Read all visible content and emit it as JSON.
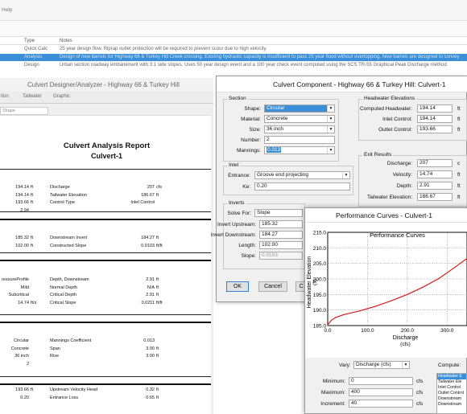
{
  "app": {
    "menu_text": "Help",
    "scenario_table": {
      "headers": [
        "Type",
        "Notes"
      ],
      "rows": [
        {
          "type": "Quick Calc",
          "notes": "25 year design flow.  Riprap outlet protection will be required to prevent scour due to high velocity."
        },
        {
          "type": "Analysis",
          "notes": "Design of new barrels for Highway 66 & Turkey Hill Creek crossing.  Existing hydraulic capacity is insufficient to pass 25 year flood without overtopping.  New barrels are designed to convey",
          "selected": true
        },
        {
          "type": "Design",
          "notes": "Urban section roadway embankment with 3:1 side slopes.  Uses 50 year design event and a 100 year check event computed using the SCS TR-55 Graphical Peak Discharge method"
        }
      ]
    }
  },
  "designer": {
    "title": "Culvert Designer/Analyzer - Highway 66 & Turkey Hill",
    "tabs": [
      "tion",
      "Tailwater",
      "Graphic"
    ],
    "combo_value": "Shape",
    "report": {
      "title": "Culvert Analysis Report",
      "subtitle": "Culvert-1",
      "rows1": [
        {
          "lv": "194.14",
          "lu": "ft",
          "rl": "Discharge",
          "rv": "207",
          "ru": "cfs"
        },
        {
          "lv": "194.14",
          "lu": "ft",
          "rl": "Tailwater Elevation",
          "rv": "186.67",
          "ru": "ft"
        },
        {
          "lv": "193.66",
          "lu": "ft",
          "rl": "Control Type",
          "rv": "Inlet Control",
          "ru": ""
        },
        {
          "lv": "2.94",
          "lu": "",
          "rl": "",
          "rv": "",
          "ru": ""
        }
      ],
      "rows2": [
        {
          "lv": "185.32",
          "lu": "ft",
          "rl": "Downstream Invert",
          "rv": "184.27",
          "ru": "ft"
        },
        {
          "lv": "102.00",
          "lu": "ft",
          "rl": "Constructed Slope",
          "rv": "0.0103",
          "ru": "ft/ft"
        }
      ],
      "rows3": [
        {
          "lv": "ressureProfile",
          "lu": "",
          "rl": "Depth, Downstream",
          "rv": "2.91",
          "ru": "ft"
        },
        {
          "lv": "Mild",
          "lu": "",
          "rl": "Normal Depth",
          "rv": "N/A",
          "ru": "ft"
        },
        {
          "lv": "Subcritical",
          "lu": "",
          "rl": "Critical Depth",
          "rv": "2.91",
          "ru": "ft"
        },
        {
          "lv": "14.74",
          "lu": "ft/s",
          "rl": "Critical Slope",
          "rv": "0.0211",
          "ru": "ft/ft"
        }
      ],
      "rows4": [
        {
          "lv": "Circular",
          "lu": "",
          "rl": "Mannings Coefficient",
          "rv": "0.013",
          "ru": ""
        },
        {
          "lv": "Concrete",
          "lu": "",
          "rl": "Span",
          "rv": "3.00",
          "ru": "ft"
        },
        {
          "lv": "36 inch",
          "lu": "",
          "rl": "Rise",
          "rv": "3.00",
          "ru": "ft"
        },
        {
          "lv": "2",
          "lu": "",
          "rl": "",
          "rv": "",
          "ru": ""
        }
      ],
      "rows5": [
        {
          "lv": "193.66",
          "lu": "ft",
          "rl": "Upstream Velocity Head",
          "rv": "0.32",
          "ru": "ft"
        },
        {
          "lv": "0.20",
          "lu": "",
          "rl": "Entrance Loss",
          "rv": "0.65",
          "ru": "ft"
        }
      ]
    }
  },
  "dialog": {
    "title": "Culvert Component - Highway 66 & Turkey Hill: Culvert-1",
    "section": {
      "label": "Section",
      "shape_label": "Shape:",
      "shape": "Circular",
      "material_label": "Material:",
      "material": "Concrete",
      "size_label": "Size:",
      "size": "36 inch",
      "number_label": "Number:",
      "number": "2",
      "mannings_label": "Mannings:",
      "mannings": "0.013"
    },
    "inlet": {
      "label": "Inlet",
      "entrance_label": "Entrance:",
      "entrance": "Groove end projecting",
      "ke_label": "Ke:",
      "ke": "0.20"
    },
    "inverts": {
      "label": "Inverts",
      "solve_label": "Solve For:",
      "solve": "Slope",
      "upstream_label": "Invert Upstream:",
      "upstream": "185.32",
      "downstream_label": "Invert Downstream:",
      "downstream": "184.27",
      "length_label": "Length:",
      "length": "102.00",
      "slope_label": "Slope:",
      "slope": "0.0103"
    },
    "headwater": {
      "label": "Headwater Elevations",
      "computed_label": "Computed Headwater:",
      "computed": "194.14",
      "computed_unit": "ft",
      "inlet_label": "Inlet Control:",
      "inlet": "194.14",
      "inlet_unit": "ft",
      "outlet_label": "Outlet Control:",
      "outlet": "193.66",
      "outlet_unit": "ft"
    },
    "exit": {
      "label": "Exit Results",
      "discharge_label": "Discharge:",
      "discharge": "207",
      "discharge_unit": "c",
      "velocity_label": "Velocity:",
      "velocity": "14.74",
      "velocity_unit": "ft",
      "depth_label": "Depth:",
      "depth": "2.91",
      "depth_unit": "ft",
      "tailwater_label": "Tailwater Elevation:",
      "tailwater": "186.67",
      "tailwater_unit": "ft"
    },
    "ok": "OK",
    "cancel": "Cancel",
    "third_button": "C"
  },
  "perf": {
    "title": "Performance Curves - Culvert-1",
    "vary_label": "Vary:",
    "vary": "Discharge (cfs)",
    "compute_label": "Compute:",
    "minimum_label": "Minimum:",
    "minimum": "0",
    "minimum_unit": "cfs",
    "maximum_label": "Maximum:",
    "maximum": "400",
    "maximum_unit": "cfs",
    "increment_label": "Increment:",
    "increment": "40",
    "increment_unit": "cfs",
    "compute_options": [
      "Headwater E",
      "Tailwater Ele",
      "Inlet Control",
      "Outlet Control",
      "Downstream",
      "Downstream"
    ]
  },
  "chart_data": {
    "type": "line",
    "title": "Performance Curves",
    "xlabel": "Discharge",
    "xlabel_unit": "(cfs)",
    "ylabel": "Headwater Elevation",
    "ylabel_unit": "(ft)",
    "xlim": [
      0,
      350
    ],
    "ylim": [
      185.0,
      215.0
    ],
    "x_ticks": [
      0,
      100,
      200,
      300
    ],
    "x_tick_labels": [
      "0.0",
      "100.0",
      "200.0",
      "300.0"
    ],
    "y_ticks": [
      185,
      190,
      195,
      200,
      205,
      210,
      215
    ],
    "y_tick_labels": [
      "185.0",
      "190.0",
      "195.0",
      "200.0",
      "205.0",
      "210.0",
      "215.0"
    ],
    "grid": true,
    "line_color": "#d81b1b",
    "series": [
      {
        "x": [
          0,
          10,
          20,
          40,
          80,
          120,
          160,
          200,
          240,
          280,
          320,
          350
        ],
        "y": [
          185.3,
          186.8,
          187.6,
          188.5,
          189.7,
          191.2,
          193.0,
          195.0,
          197.4,
          200.2,
          203.8,
          206.6
        ]
      }
    ]
  }
}
